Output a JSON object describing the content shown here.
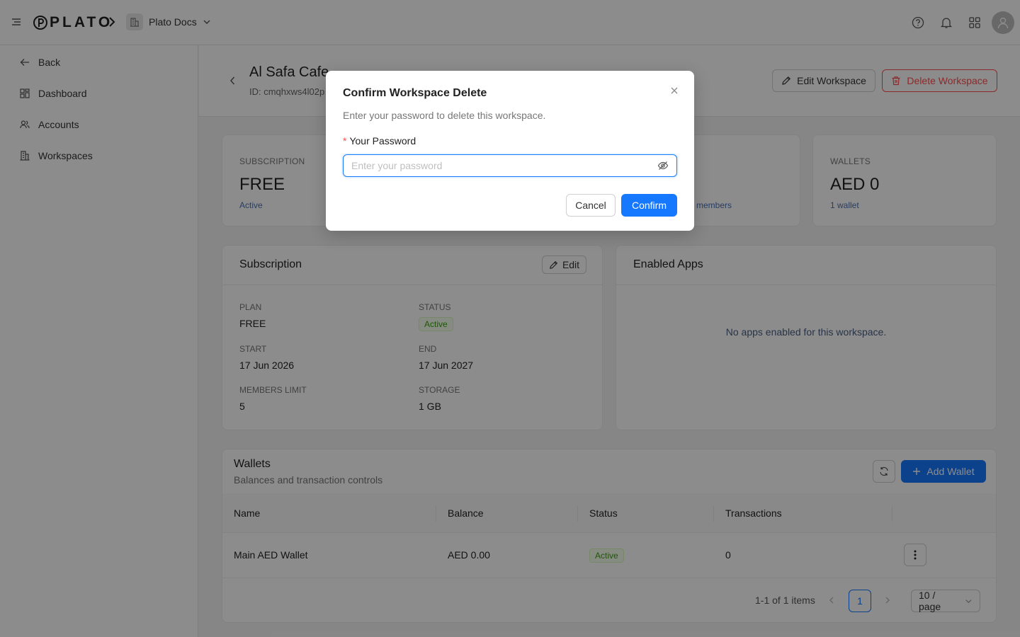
{
  "topbar": {
    "logo_text": "PLATO",
    "workspace_name": "Plato Docs"
  },
  "sidebar": {
    "items": [
      {
        "label": "Back",
        "icon": "arrow-left-icon"
      },
      {
        "label": "Dashboard",
        "icon": "dashboard-icon"
      },
      {
        "label": "Accounts",
        "icon": "users-icon"
      },
      {
        "label": "Workspaces",
        "icon": "building-icon"
      }
    ]
  },
  "header": {
    "title": "Al Safa Cafe",
    "id_text": "ID: cmqhxws4l02p",
    "edit_label": "Edit Workspace",
    "delete_label": "Delete Workspace"
  },
  "stats": [
    {
      "label": "SUBSCRIPTION",
      "value": "FREE",
      "sub": "Active"
    },
    {
      "label": "",
      "value": "",
      "sub": "members"
    },
    {
      "label": "WALLETS",
      "value": "AED 0",
      "sub": "1 wallet"
    }
  ],
  "subscription": {
    "title": "Subscription",
    "edit_label": "Edit",
    "plan_label": "PLAN",
    "plan_value": "FREE",
    "status_label": "STATUS",
    "status_value": "Active",
    "start_label": "START",
    "start_value": "17 Jun 2026",
    "end_label": "END",
    "end_value": "17 Jun 2027",
    "members_label": "MEMBERS LIMIT",
    "members_value": "5",
    "storage_label": "STORAGE",
    "storage_value": "1 GB"
  },
  "apps": {
    "title": "Enabled Apps",
    "empty_text": "No apps enabled for this workspace."
  },
  "wallets": {
    "title": "Wallets",
    "subtitle": "Balances and transaction controls",
    "add_label": "Add Wallet",
    "columns": [
      "Name",
      "Balance",
      "Status",
      "Transactions"
    ],
    "rows": [
      {
        "name": "Main AED Wallet",
        "balance": "AED 0.00",
        "status": "Active",
        "transactions": "0"
      }
    ],
    "pagination_text": "1-1 of 1 items",
    "current_page": "1",
    "page_size": "10 / page"
  },
  "modal": {
    "title": "Confirm Workspace Delete",
    "description": "Enter your password to delete this workspace.",
    "required_mark": "*",
    "field_label": "Your Password",
    "placeholder": "Enter your password",
    "cancel_label": "Cancel",
    "confirm_label": "Confirm"
  },
  "colors": {
    "primary": "#1677ff",
    "danger": "#ff4d4f",
    "success": "#389e0d"
  }
}
